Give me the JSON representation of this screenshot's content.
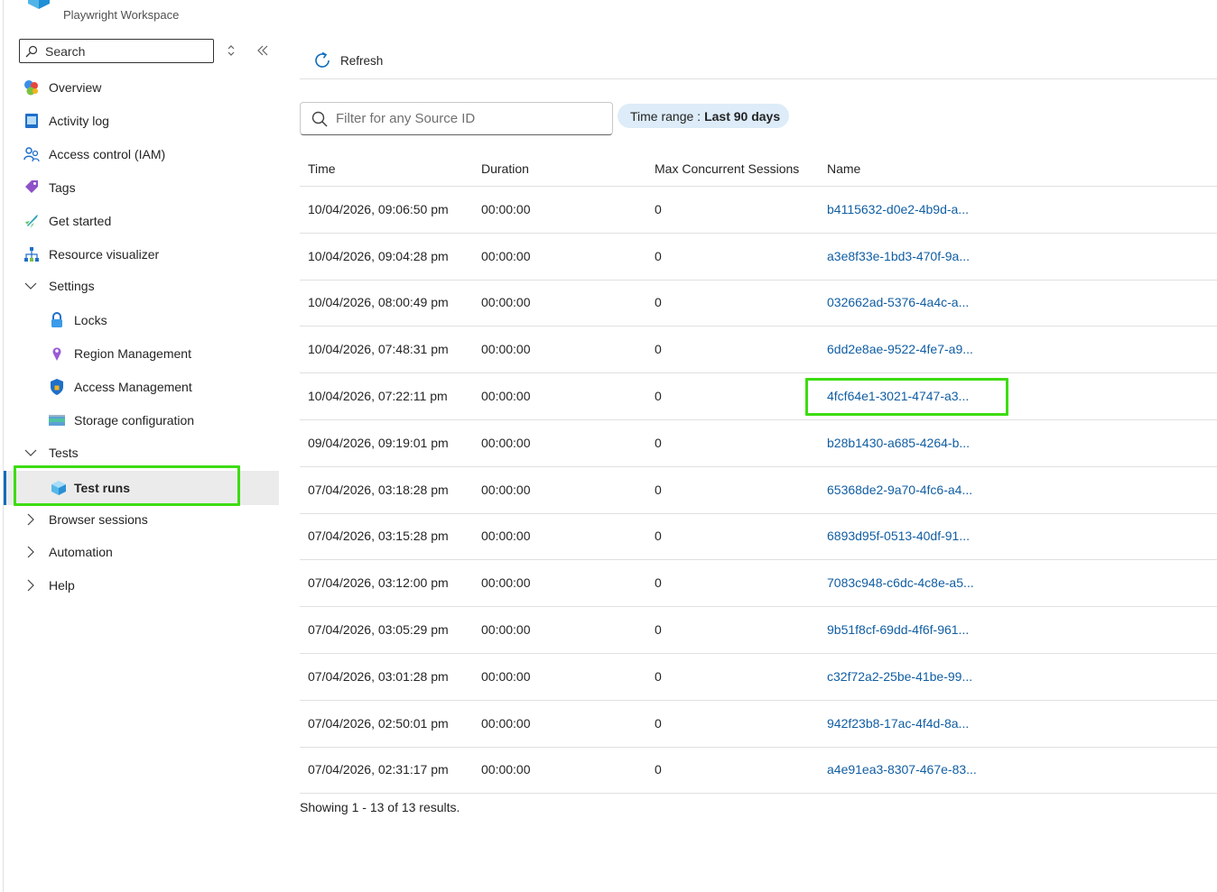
{
  "resource": {
    "subtitle": "Playwright Workspace"
  },
  "sidebar": {
    "search_label": "Search",
    "items": [
      {
        "label": "Overview"
      },
      {
        "label": "Activity log"
      },
      {
        "label": "Access control (IAM)"
      },
      {
        "label": "Tags"
      },
      {
        "label": "Get started"
      },
      {
        "label": "Resource visualizer"
      },
      {
        "label": "Settings",
        "expanded": true
      },
      {
        "label": "Locks"
      },
      {
        "label": "Region Management"
      },
      {
        "label": "Access Management"
      },
      {
        "label": "Storage configuration"
      },
      {
        "label": "Tests",
        "expanded": true
      },
      {
        "label": "Test runs",
        "selected": true
      },
      {
        "label": "Browser sessions",
        "expanded": false
      },
      {
        "label": "Automation",
        "expanded": false
      },
      {
        "label": "Help",
        "expanded": false
      }
    ]
  },
  "toolbar": {
    "refresh_label": "Refresh"
  },
  "filter": {
    "placeholder": "Filter for any Source ID"
  },
  "time_range": {
    "label": "Time range :",
    "value": "Last 90 days"
  },
  "table": {
    "columns": [
      "Time",
      "Duration",
      "Max Concurrent Sessions",
      "Name"
    ],
    "rows": [
      {
        "time": "10/04/2026, 09:06:50 pm",
        "duration": "00:00:00",
        "max": "0",
        "name": "b4115632-d0e2-4b9d-a..."
      },
      {
        "time": "10/04/2026, 09:04:28 pm",
        "duration": "00:00:00",
        "max": "0",
        "name": "a3e8f33e-1bd3-470f-9a..."
      },
      {
        "time": "10/04/2026, 08:00:49 pm",
        "duration": "00:00:00",
        "max": "0",
        "name": "032662ad-5376-4a4c-a..."
      },
      {
        "time": "10/04/2026, 07:48:31 pm",
        "duration": "00:00:00",
        "max": "0",
        "name": "6dd2e8ae-9522-4fe7-a9..."
      },
      {
        "time": "10/04/2026, 07:22:11 pm",
        "duration": "00:00:00",
        "max": "0",
        "name": "4fcf64e1-3021-4747-a3..."
      },
      {
        "time": "09/04/2026, 09:19:01 pm",
        "duration": "00:00:00",
        "max": "0",
        "name": "b28b1430-a685-4264-b..."
      },
      {
        "time": "07/04/2026, 03:18:28 pm",
        "duration": "00:00:00",
        "max": "0",
        "name": "65368de2-9a70-4fc6-a4..."
      },
      {
        "time": "07/04/2026, 03:15:28 pm",
        "duration": "00:00:00",
        "max": "0",
        "name": "6893d95f-0513-40df-91..."
      },
      {
        "time": "07/04/2026, 03:12:00 pm",
        "duration": "00:00:00",
        "max": "0",
        "name": "7083c948-c6dc-4c8e-a5..."
      },
      {
        "time": "07/04/2026, 03:05:29 pm",
        "duration": "00:00:00",
        "max": "0",
        "name": "9b51f8cf-69dd-4f6f-961..."
      },
      {
        "time": "07/04/2026, 03:01:28 pm",
        "duration": "00:00:00",
        "max": "0",
        "name": "c32f72a2-25be-41be-99..."
      },
      {
        "time": "07/04/2026, 02:50:01 pm",
        "duration": "00:00:00",
        "max": "0",
        "name": "942f23b8-17ac-4f4d-8a..."
      },
      {
        "time": "07/04/2026, 02:31:17 pm",
        "duration": "00:00:00",
        "max": "0",
        "name": "a4e91ea3-8307-467e-83..."
      }
    ]
  },
  "footer": {
    "results_text": "Showing 1 - 13 of 13 results."
  },
  "colors": {
    "accent": "#0f6cbd",
    "link": "#115ea3",
    "highlight": "#3ddc11",
    "pill": "#ddecf8"
  }
}
